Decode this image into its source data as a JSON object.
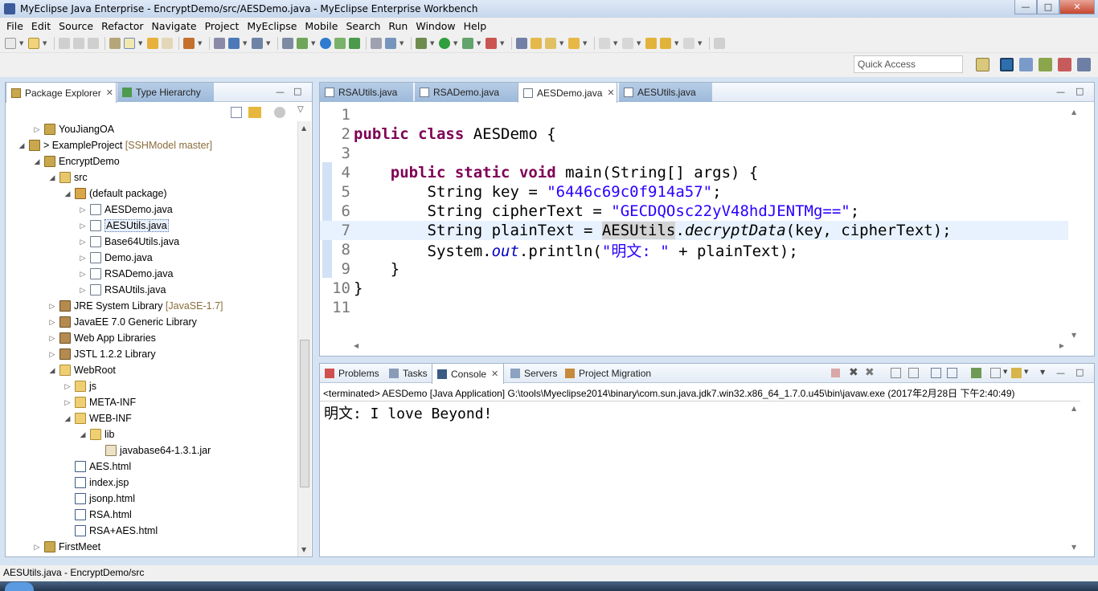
{
  "window": {
    "title": "MyEclipse Java Enterprise - EncryptDemo/src/AESDemo.java - MyEclipse Enterprise Workbench",
    "min": "—",
    "max": "□",
    "close": "✕"
  },
  "menu": [
    "File",
    "Edit",
    "Source",
    "Refactor",
    "Navigate",
    "Project",
    "MyEclipse",
    "Mobile",
    "Search",
    "Run",
    "Window",
    "Help"
  ],
  "quick_access": {
    "placeholder": "Quick Access"
  },
  "explorer": {
    "tabs": [
      {
        "label": "Package Explorer",
        "active": true,
        "close": "✕"
      },
      {
        "label": "Type Hierarchy",
        "active": false
      }
    ],
    "tree": [
      {
        "depth": 1,
        "twisty": "▷",
        "icon": "project",
        "label": "YouJiangOA",
        "dec": ""
      },
      {
        "depth": 0,
        "twisty": "◢",
        "icon": "project",
        "label": "> ExampleProject",
        "dec": " [SSHModel master]"
      },
      {
        "depth": 1,
        "twisty": "◢",
        "icon": "project",
        "label": "EncryptDemo",
        "dec": ""
      },
      {
        "depth": 2,
        "twisty": "◢",
        "icon": "src",
        "label": "src",
        "dec": ""
      },
      {
        "depth": 3,
        "twisty": "◢",
        "icon": "pkg",
        "label": "(default package)",
        "dec": ""
      },
      {
        "depth": 4,
        "twisty": "▷",
        "icon": "java",
        "label": "AESDemo.java",
        "dec": ""
      },
      {
        "depth": 4,
        "twisty": "▷",
        "icon": "java",
        "label": "AESUtils.java",
        "dec": "",
        "selected": true
      },
      {
        "depth": 4,
        "twisty": "▷",
        "icon": "java",
        "label": "Base64Utils.java",
        "dec": ""
      },
      {
        "depth": 4,
        "twisty": "▷",
        "icon": "java",
        "label": "Demo.java",
        "dec": ""
      },
      {
        "depth": 4,
        "twisty": "▷",
        "icon": "java",
        "label": "RSADemo.java",
        "dec": ""
      },
      {
        "depth": 4,
        "twisty": "▷",
        "icon": "java",
        "label": "RSAUtils.java",
        "dec": ""
      },
      {
        "depth": 2,
        "twisty": "▷",
        "icon": "lib",
        "label": "JRE System Library",
        "dec": " [JavaSE-1.7]"
      },
      {
        "depth": 2,
        "twisty": "▷",
        "icon": "lib",
        "label": "JavaEE 7.0 Generic Library",
        "dec": ""
      },
      {
        "depth": 2,
        "twisty": "▷",
        "icon": "lib",
        "label": "Web App Libraries",
        "dec": ""
      },
      {
        "depth": 2,
        "twisty": "▷",
        "icon": "lib",
        "label": "JSTL 1.2.2 Library",
        "dec": ""
      },
      {
        "depth": 2,
        "twisty": "◢",
        "icon": "folder",
        "label": "WebRoot",
        "dec": ""
      },
      {
        "depth": 3,
        "twisty": "▷",
        "icon": "folder",
        "label": "js",
        "dec": ""
      },
      {
        "depth": 3,
        "twisty": "▷",
        "icon": "folder",
        "label": "META-INF",
        "dec": ""
      },
      {
        "depth": 3,
        "twisty": "◢",
        "icon": "folder",
        "label": "WEB-INF",
        "dec": ""
      },
      {
        "depth": 4,
        "twisty": "◢",
        "icon": "folder",
        "label": "lib",
        "dec": ""
      },
      {
        "depth": 5,
        "twisty": "",
        "icon": "jar",
        "label": "javabase64-1.3.1.jar",
        "dec": ""
      },
      {
        "depth": 3,
        "twisty": "",
        "icon": "html",
        "label": "AES.html",
        "dec": ""
      },
      {
        "depth": 3,
        "twisty": "",
        "icon": "html",
        "label": "index.jsp",
        "dec": ""
      },
      {
        "depth": 3,
        "twisty": "",
        "icon": "html",
        "label": "jsonp.html",
        "dec": ""
      },
      {
        "depth": 3,
        "twisty": "",
        "icon": "html",
        "label": "RSA.html",
        "dec": ""
      },
      {
        "depth": 3,
        "twisty": "",
        "icon": "html",
        "label": "RSA+AES.html",
        "dec": ""
      },
      {
        "depth": 1,
        "twisty": "▷",
        "icon": "project",
        "label": "FirstMeet",
        "dec": ""
      }
    ]
  },
  "editor": {
    "tabs": [
      {
        "label": "RSAUtils.java",
        "active": false
      },
      {
        "label": "RSADemo.java",
        "active": false
      },
      {
        "label": "AESDemo.java",
        "active": true,
        "close": "✕"
      },
      {
        "label": "AESUtils.java",
        "active": false
      }
    ],
    "lines": [
      {
        "n": "1",
        "tokens": []
      },
      {
        "n": "2",
        "tokens": [
          [
            "kw",
            "public"
          ],
          [
            "",
            " "
          ],
          [
            "kw",
            "class"
          ],
          [
            "",
            " AESDemo {"
          ]
        ]
      },
      {
        "n": "3",
        "tokens": []
      },
      {
        "n": "4",
        "tokens": [
          [
            "",
            "    "
          ],
          [
            "kw",
            "public"
          ],
          [
            "",
            " "
          ],
          [
            "kw",
            "static"
          ],
          [
            "",
            " "
          ],
          [
            "kw",
            "void"
          ],
          [
            "",
            " main(String[] args) {"
          ]
        ]
      },
      {
        "n": "5",
        "tokens": [
          [
            "",
            "        String key = "
          ],
          [
            "str",
            "\"6446c69c0f914a57\""
          ],
          [
            "",
            ";"
          ]
        ]
      },
      {
        "n": "6",
        "tokens": [
          [
            "",
            "        String cipherText = "
          ],
          [
            "str",
            "\"GECDQOsc22yV48hdJENTMg==\""
          ],
          [
            "",
            ";"
          ]
        ]
      },
      {
        "n": "7",
        "current": true,
        "tokens": [
          [
            "",
            "        String plainText = "
          ],
          [
            "hl",
            "AESUtils"
          ],
          [
            "",
            "."
          ],
          [
            "mth",
            "decryptData"
          ],
          [
            "",
            "(key, cipherText);"
          ]
        ]
      },
      {
        "n": "8",
        "tokens": [
          [
            "",
            "        System."
          ],
          [
            "fld",
            "out"
          ],
          [
            "",
            ".println("
          ],
          [
            "str",
            "\"明文: \""
          ],
          [
            "",
            " + plainText);"
          ]
        ]
      },
      {
        "n": "9",
        "tokens": [
          [
            "",
            "    }"
          ]
        ]
      },
      {
        "n": "10",
        "tokens": [
          [
            "",
            "}"
          ]
        ]
      },
      {
        "n": "11",
        "tokens": []
      }
    ]
  },
  "console": {
    "tabs": [
      {
        "label": "Problems",
        "active": false
      },
      {
        "label": "Tasks",
        "active": false
      },
      {
        "label": "Console",
        "active": true,
        "close": "✕"
      },
      {
        "label": "Servers",
        "active": false
      },
      {
        "label": "Project Migration",
        "active": false
      }
    ],
    "terminated": "<terminated> AESDemo [Java Application] G:\\tools\\Myeclipse2014\\binary\\com.sun.java.jdk7.win32.x86_64_1.7.0.u45\\bin\\javaw.exe (2017年2月28日 下午2:40:49)",
    "output": "明文: I love Beyond!"
  },
  "status": {
    "text": "AESUtils.java - EncryptDemo/src"
  },
  "colors": {
    "keyword": "#7f0055",
    "string": "#2a00ff",
    "field": "#0000c0",
    "line_number": "#787878"
  }
}
